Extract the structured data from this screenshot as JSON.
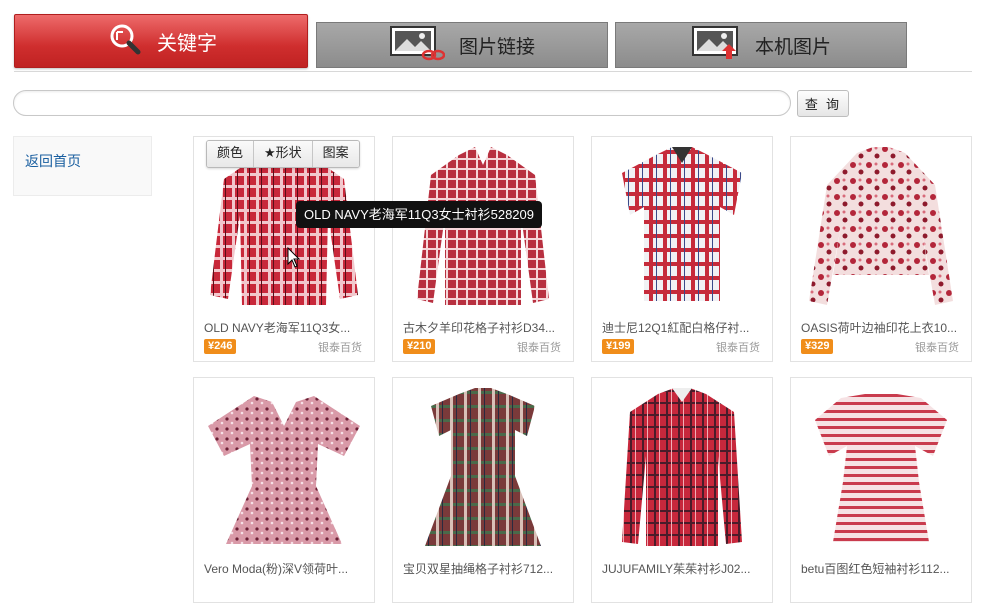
{
  "tabs": [
    {
      "label": "关键字",
      "icon": "magnifier-icon",
      "active": true
    },
    {
      "label": "图片链接",
      "icon": "image-link-icon",
      "active": false
    },
    {
      "label": "本机图片",
      "icon": "image-upload-icon",
      "active": false
    }
  ],
  "search": {
    "value": "",
    "placeholder": "",
    "button_label": "查 询"
  },
  "sidebar": {
    "home_link": "返回首页"
  },
  "filter_bar": {
    "color": "颜色",
    "shape": "★形状",
    "pattern": "图案"
  },
  "tooltip": "OLD NAVY老海军11Q3女士衬衫528209",
  "products": [
    {
      "name": "OLD NAVY老海军11Q3女...",
      "price": "¥246",
      "source": "银泰百货"
    },
    {
      "name": "古木夕羊印花格子衬衫D34...",
      "price": "¥210",
      "source": "银泰百货"
    },
    {
      "name": "迪士尼12Q1紅配白格仔衬...",
      "price": "¥199",
      "source": "银泰百货"
    },
    {
      "name": "OASIS荷叶边袖印花上衣10...",
      "price": "¥329",
      "source": "银泰百货"
    },
    {
      "name": "Vero Moda(粉)深V领荷叶...",
      "price": "",
      "source": ""
    },
    {
      "name": "宝贝双星抽绳格子衬衫712...",
      "price": "",
      "source": ""
    },
    {
      "name": "JUJUFAMILY茱茱衬衫J02...",
      "price": "",
      "source": ""
    },
    {
      "name": "betu百图红色短袖衬衫112...",
      "price": "",
      "source": ""
    }
  ],
  "colors": {
    "accent": "#d33a3a",
    "price_badge": "#f08d1a",
    "link": "#1a5fa0"
  }
}
